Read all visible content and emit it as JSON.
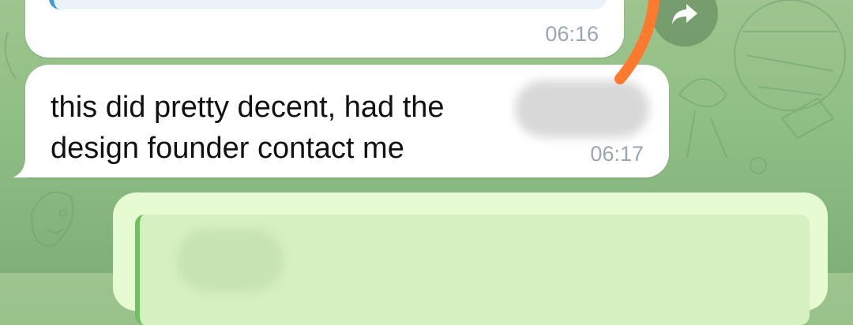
{
  "messages": [
    {
      "time": "06:16"
    },
    {
      "text": "this did pretty decent, had the\ndesign founder contact me",
      "time": "06:17"
    }
  ],
  "reply_preview": {
    "partial_text": ""
  },
  "icons": {
    "share": "share-arrow-icon"
  },
  "colors": {
    "wallpaper": "#8fbf84",
    "bubble_in": "#ffffff",
    "bubble_out": "#e7fbd3",
    "time": "#9aa7b0",
    "annotation_arrow": "#ff7a2f",
    "quote_bar_in": "#3d9bd8",
    "quote_bar_out": "#6fc05f"
  }
}
